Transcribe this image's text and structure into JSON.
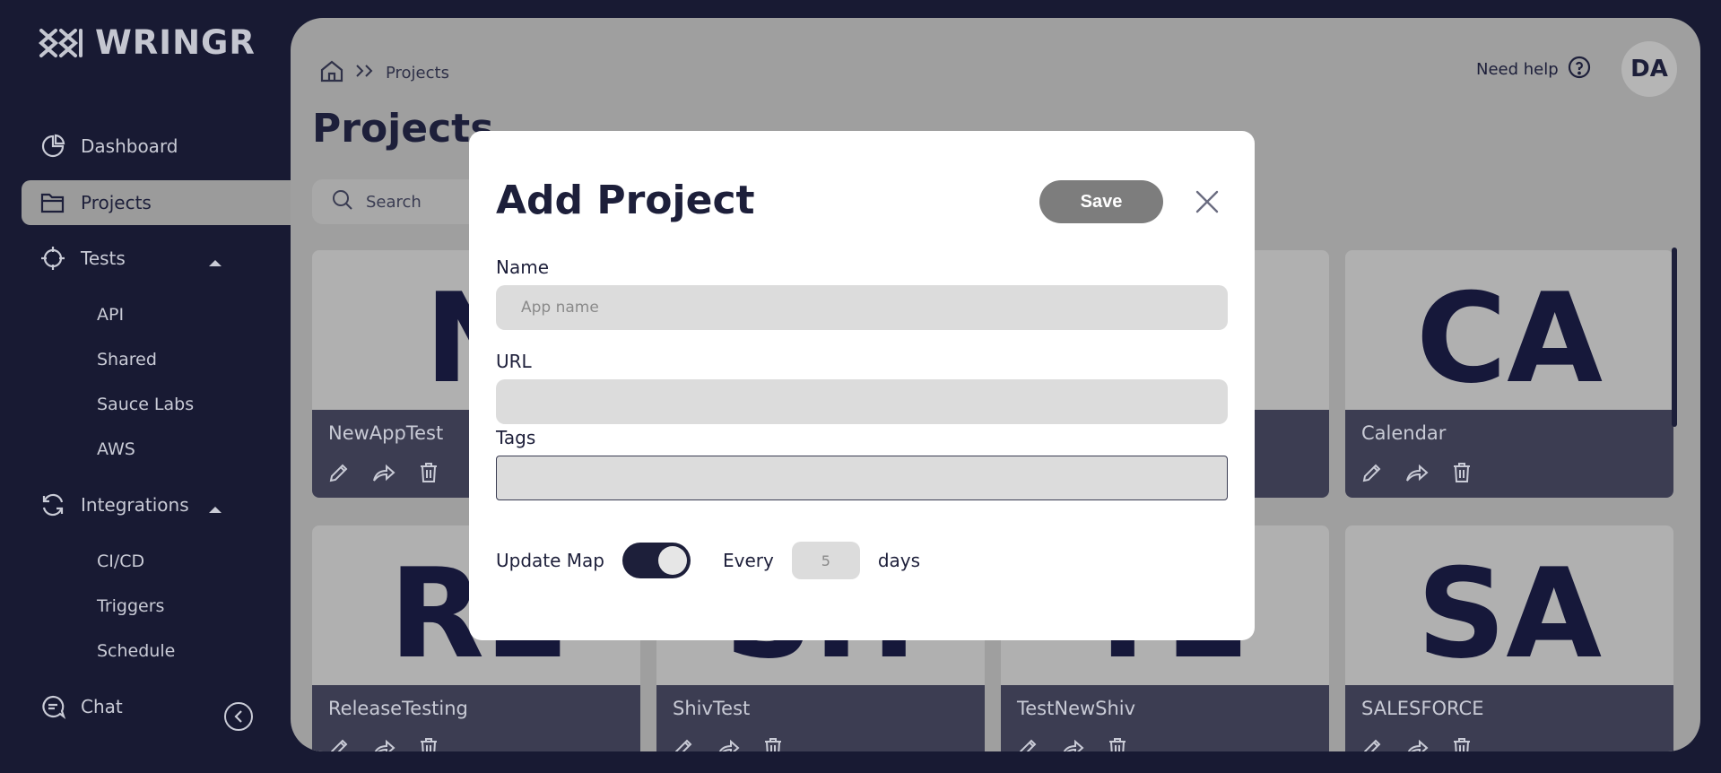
{
  "app": {
    "logo_text": "WRINGR"
  },
  "sidebar": {
    "items": [
      {
        "label": "Dashboard",
        "icon": "pie-chart-icon"
      },
      {
        "label": "Projects",
        "icon": "folder-icon"
      },
      {
        "label": "Tests",
        "icon": "crosshair-icon"
      },
      {
        "label": "Integrations",
        "icon": "refresh-icon"
      },
      {
        "label": "Chat",
        "icon": "chat-icon"
      }
    ],
    "tests_subitems": [
      "API",
      "Shared",
      "Sauce Labs",
      "AWS"
    ],
    "integrations_subitems": [
      "CI/CD",
      "Triggers",
      "Schedule"
    ]
  },
  "header": {
    "breadcrumb": "Projects",
    "title": "Projects",
    "help_label": "Need help",
    "avatar_initials": "DA"
  },
  "search": {
    "placeholder": "Search"
  },
  "projects": [
    {
      "initials": "N",
      "name": "NewAppTest"
    },
    {
      "initials": "CA",
      "name": "Calendar"
    },
    {
      "initials": "RL",
      "name": "ReleaseTesting"
    },
    {
      "initials": "SH",
      "name": "ShivTest"
    },
    {
      "initials": "TE",
      "name": "TestNewShiv"
    },
    {
      "initials": "SA",
      "name": "SALESFORCE"
    }
  ],
  "modal": {
    "title": "Add Project",
    "save_label": "Save",
    "name_label": "Name",
    "name_placeholder": "App name",
    "url_label": "URL",
    "url_value": "",
    "tags_label": "Tags",
    "tags_value": "",
    "update_map_label": "Update Map",
    "update_map_on": true,
    "every_label": "Every",
    "every_value": "5",
    "days_label": "days"
  },
  "colors": {
    "sidebar_bg": "#181a33",
    "accent_dark": "#1d1f3a",
    "save_button": "#7d7d7d"
  }
}
